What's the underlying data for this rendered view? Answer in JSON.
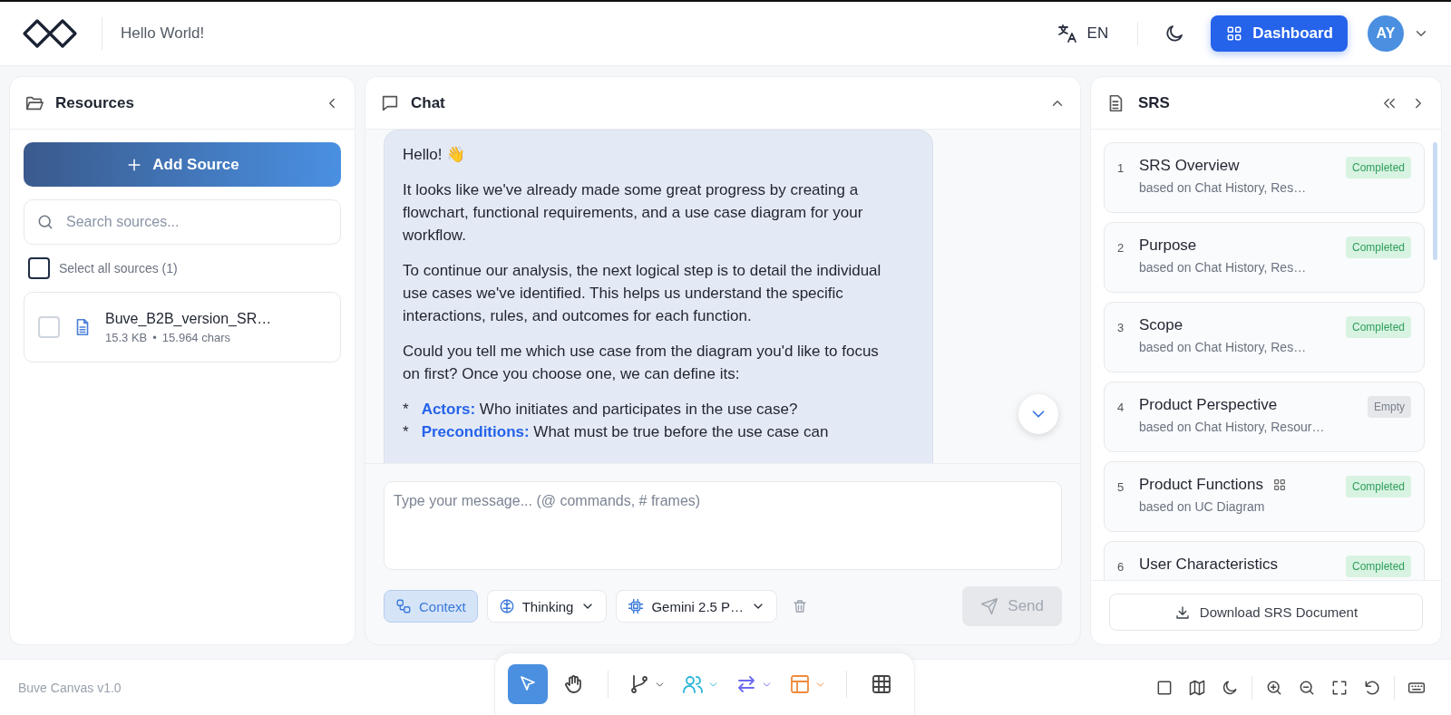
{
  "header": {
    "title": "Hello World!",
    "language": "EN",
    "dashboard_button": "Dashboard",
    "avatar": "AY"
  },
  "resources": {
    "title": "Resources",
    "add_button": "Add Source",
    "search": {
      "placeholder": "Search sources..."
    },
    "select_all": {
      "label": "Select all sources (1)",
      "checked": false
    },
    "files": [
      {
        "name": "Buve_B2B_version_SR…",
        "size": "15.3 KB",
        "separator": "•",
        "chars": "15.964 chars",
        "checked": false
      }
    ]
  },
  "chat": {
    "title": "Chat",
    "messages": [
      {
        "paragraphs": [
          "Hello! 👋",
          "It looks like we've already made some great progress by creating a flowchart, functional requirements, and a use case diagram for your workflow.",
          "To continue our analysis, the next logical step is to detail the individual use cases we've identified. This helps us understand the specific interactions, rules, and outcomes for each function.",
          "Could you tell me which use case from the diagram you'd like to focus on first? Once you choose one, we can define its:"
        ],
        "bullets": [
          {
            "marker": "*",
            "text": "**Actors:** Who initiates and participates in the use case?"
          },
          {
            "marker": "*",
            "text": "**Preconditions:** What must be true before the use case can"
          }
        ]
      }
    ],
    "input": {
      "placeholder": "Type your message... (@ commands, # frames)"
    },
    "options": [
      {
        "kind": "toggle",
        "label": "Context",
        "on": true
      },
      {
        "kind": "thinking",
        "label": "Thinking"
      },
      {
        "kind": "model",
        "label": "Gemini 2.5 P…"
      }
    ],
    "send_button": {
      "label": "Send",
      "disabled": true
    }
  },
  "srs": {
    "title": "SRS",
    "sections": [
      {
        "number": "1",
        "title": "SRS Overview",
        "source": "based on Chat History, Res…",
        "status": {
          "label": "Completed",
          "kind": "completed"
        },
        "has_frame_icon": false
      },
      {
        "number": "2",
        "title": "Purpose",
        "source": "based on Chat History, Res…",
        "status": {
          "label": "Completed",
          "kind": "completed"
        },
        "has_frame_icon": false
      },
      {
        "number": "3",
        "title": "Scope",
        "source": "based on Chat History, Res…",
        "status": {
          "label": "Completed",
          "kind": "completed"
        },
        "has_frame_icon": false
      },
      {
        "number": "4",
        "title": "Product Perspective",
        "source": "based on Chat History, Resour…",
        "status": {
          "label": "Empty",
          "kind": "empty"
        },
        "has_frame_icon": false
      },
      {
        "number": "5",
        "title": "Product Functions",
        "source": "based on UC Diagram",
        "status": {
          "label": "Completed",
          "kind": "completed"
        },
        "has_frame_icon": true
      },
      {
        "number": "6",
        "title": "User Characteristics",
        "status": {
          "label": "Completed",
          "kind": "completed"
        },
        "has_frame_icon": false
      }
    ],
    "download_button": "Download SRS Document"
  },
  "toolbar": {
    "tools": [
      {
        "kind": "select",
        "selected": true,
        "has_menu": false
      },
      {
        "kind": "hand",
        "selected": false,
        "has_menu": false
      },
      {
        "kind": "branch",
        "selected": false,
        "has_menu": true
      },
      {
        "kind": "users",
        "selected": false,
        "has_menu": true
      },
      {
        "kind": "arrows",
        "selected": false,
        "has_menu": true
      },
      {
        "kind": "layout",
        "selected": false,
        "has_menu": true
      },
      {
        "kind": "table",
        "selected": false,
        "has_menu": false
      }
    ]
  },
  "status_bar": {
    "version": "Buve Canvas v1.0"
  }
}
